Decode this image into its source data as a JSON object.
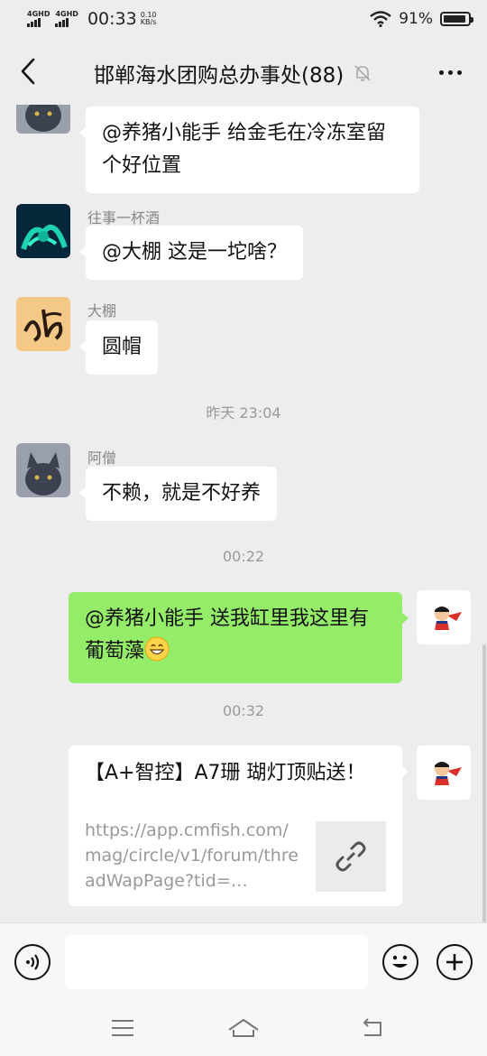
{
  "status_bar": {
    "network1": "4GHD",
    "network2": "4GHD",
    "time": "00:33",
    "speed_value": "0.10",
    "speed_unit": "KB/s",
    "battery_pct": "91%",
    "battery_level": 0.91
  },
  "header": {
    "title": "邯郸海水团购总办事处(88)",
    "muted": true
  },
  "messages": [
    {
      "sender": "",
      "side": "left",
      "avatar": "gray-cat",
      "text": "@养猪小能手  给金毛在冷冻室留个好位置"
    },
    {
      "sender": "往事一杯酒",
      "side": "left",
      "avatar": "green-coral",
      "text": "@大棚  这是一坨啥？"
    },
    {
      "sender": "大棚",
      "side": "left",
      "avatar": "calligraphy",
      "text": "圆帽"
    },
    {
      "timestamp": "昨天 23:04"
    },
    {
      "sender": "阿僧",
      "side": "left",
      "avatar": "gray-cat",
      "text": "不赖，就是不好养"
    },
    {
      "timestamp": "00:22"
    },
    {
      "sender": "",
      "side": "right",
      "avatar": "superhero-cartoon",
      "text": "@养猪小能手  送我缸里我这里有葡萄藻",
      "emoji": "grinning-face-icon"
    },
    {
      "timestamp": "00:32"
    },
    {
      "side": "right",
      "avatar": "superhero-cartoon",
      "card": {
        "title": "【A+智控】A7珊 瑚灯顶贴送！",
        "url": "https://app.cmfish.com/mag/circle/v1/forum/threadWapPage?tid=…",
        "icon": "link-icon"
      }
    }
  ],
  "input_bar": {
    "voice_icon": "voice-icon",
    "input_value": "",
    "emoji_icon": "emoji-icon",
    "plus_icon": "plus-icon"
  },
  "nav_bar": {
    "menu_icon": "menu-icon",
    "home_icon": "home-icon",
    "back_icon": "back-icon"
  },
  "colors": {
    "background": "#ededed",
    "self_bubble": "#95ec69",
    "other_bubble": "#ffffff",
    "meta_text": "#999999"
  }
}
